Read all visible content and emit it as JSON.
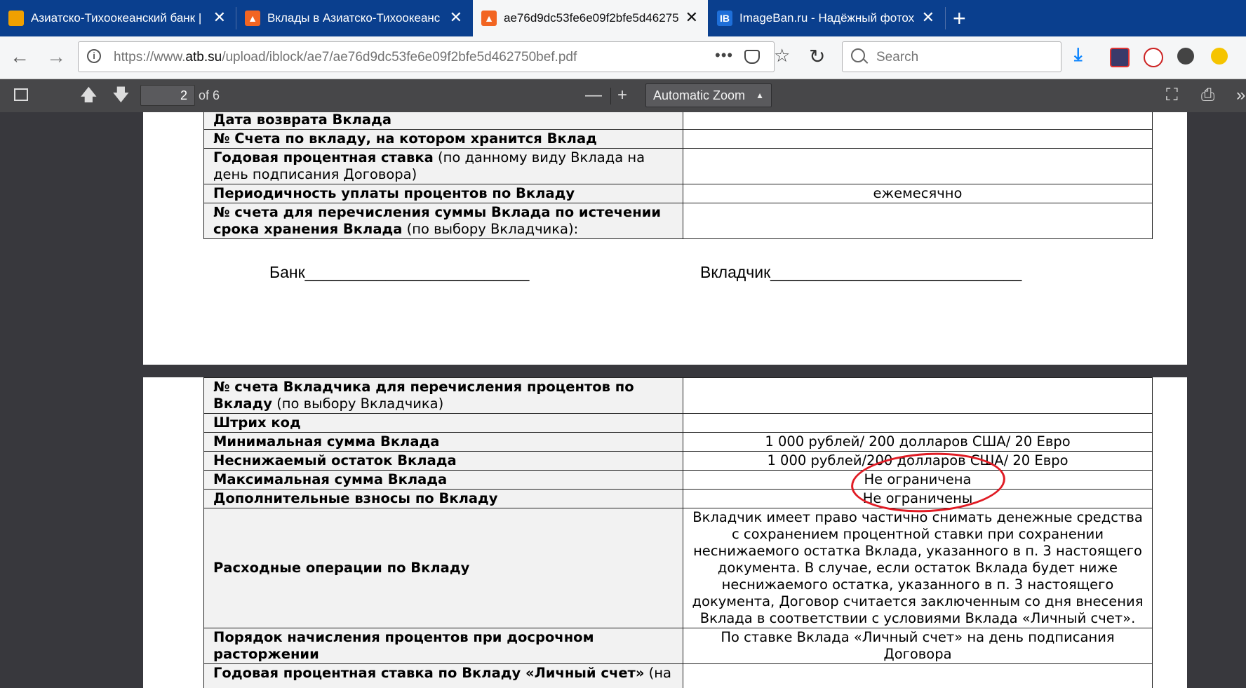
{
  "tabs": [
    {
      "title": "Азиатско-Тихоокеанский банк | ",
      "favicon_color": "#f0a000",
      "active": false
    },
    {
      "title": "Вклады в Азиатско-Тихоокеанс",
      "favicon_color": "#f26522",
      "active": false
    },
    {
      "title": "ae76d9dc53fe6e09f2bfe5d46275",
      "favicon_color": "#f26522",
      "active": true
    },
    {
      "title": "ImageBan.ru - Надёжный фотох",
      "favicon_color": "#1e6fd9",
      "favicon_text": "IB",
      "active": false
    }
  ],
  "url": {
    "scheme": "https://www.",
    "host": "atb.su",
    "path": "/upload/iblock/ae7/ae76d9dc53fe6e09f2bfe5d462750bef.pdf"
  },
  "search": {
    "placeholder": "Search"
  },
  "pdf_toolbar": {
    "page_current": "2",
    "page_count": "of 6",
    "zoom": "Automatic Zoom"
  },
  "page1": {
    "rows": [
      {
        "label_bold": "Дата возврата Вклада",
        "label_normal": "",
        "value": ""
      },
      {
        "label_bold": "№ Счета по вкладу, на котором хранится Вклад",
        "label_normal": "",
        "value": ""
      },
      {
        "label_bold": "Годовая процентная ставка",
        "label_normal": " (по данному виду Вклада на день подписания Договора)",
        "value": ""
      },
      {
        "label_bold": "Периодичность уплаты процентов по Вкладу",
        "label_normal": "",
        "value": "ежемесячно"
      },
      {
        "label_bold": "№ счета для перечисления суммы Вклада по истечении срока хранения Вклада",
        "label_normal": " (по выбору Вкладчика):",
        "value": ""
      }
    ],
    "sign_bank": "Банк_________________________",
    "sign_depositor": "Вкладчик____________________________"
  },
  "page2": {
    "rows": [
      {
        "label_bold": "№ счета Вкладчика для перечисления процентов по Вкладу",
        "label_normal": " (по выбору Вкладчика)",
        "value": ""
      },
      {
        "label_bold": "Штрих код",
        "label_normal": "",
        "value": ""
      },
      {
        "label_bold": "Минимальная сумма Вклада",
        "label_normal": "",
        "value": "1 000 рублей/ 200 долларов США/ 20 Евро"
      },
      {
        "label_bold": "Неснижаемый остаток Вклада",
        "label_normal": "",
        "value": "1 000 рублей/200 долларов США/ 20 Евро"
      },
      {
        "label_bold": "Максимальная сумма Вклада",
        "label_normal": "",
        "value": "Не ограничена"
      },
      {
        "label_bold": "Дополнительные взносы по Вкладу",
        "label_normal": "",
        "value": "Не ограничены"
      },
      {
        "label_bold": "Расходные операции по Вкладу",
        "label_normal": "",
        "value": "Вкладчик имеет право частично снимать денежные средства с сохранением процентной ставки при сохранении неснижаемого остатка Вклада, указанного в п. 3 настоящего документа. В случае, если остаток Вклада будет ниже неснижаемого остатка, указанного в п. 3 настоящего документа, Договор считается заключенным со дня внесения Вклада в соответствии с условиями Вклада «Личный счет»."
      },
      {
        "label_bold": "Порядок начисления процентов при досрочном расторжении",
        "label_normal": "",
        "value": "По ставке Вклада «Личный счет» на день подписания Договора"
      },
      {
        "label_bold": "Годовая процентная ставка по Вкладу «Личный счет»",
        "label_normal": " (на",
        "value": ""
      }
    ]
  },
  "annotation": {
    "color": "#e01b24"
  }
}
